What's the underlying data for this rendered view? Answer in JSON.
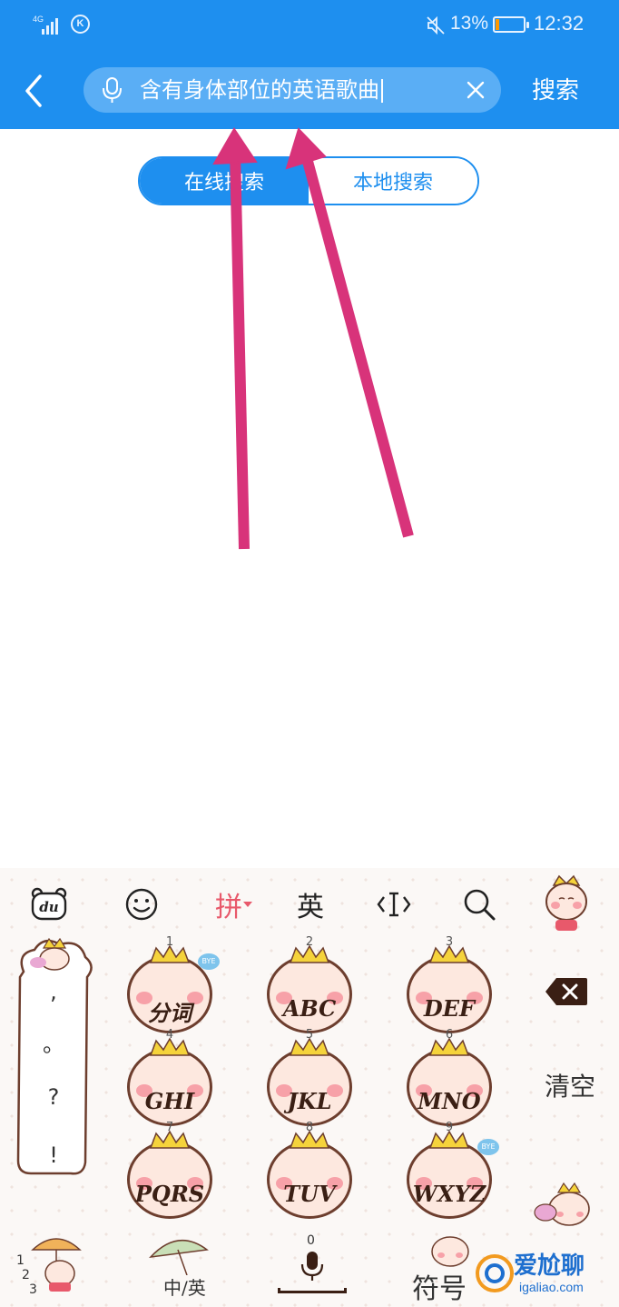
{
  "status_bar": {
    "network_type": "4G",
    "carrier_badge": "K",
    "battery_percent": "13%",
    "battery_level": 0.13,
    "time": "12:32",
    "icons": [
      "signal-icon",
      "mute-icon",
      "battery-icon"
    ]
  },
  "header": {
    "back_icon": "chevron-left-icon",
    "search": {
      "value": "含有身体部位的英语歌曲",
      "mic_icon": "voice-search-icon",
      "clear_icon": "close-icon"
    },
    "search_button": "搜索"
  },
  "tabs": [
    {
      "label": "在线搜索",
      "active": true
    },
    {
      "label": "本地搜索",
      "active": false
    }
  ],
  "annotations": {
    "arrow_color": "#d8337a",
    "count": 2
  },
  "keyboard": {
    "toolbar": {
      "pinyin": "拼",
      "english": "英",
      "icons": [
        "du-logo-icon",
        "emoji-icon",
        "cursor-icon",
        "search-icon",
        "mascot-icon"
      ]
    },
    "punctuation": [
      ",",
      "。",
      "?",
      "!"
    ],
    "keys": [
      {
        "num": "1",
        "label": "分词"
      },
      {
        "num": "2",
        "label": "ABC"
      },
      {
        "num": "3",
        "label": "DEF"
      },
      {
        "num": "4",
        "label": "GHI"
      },
      {
        "num": "5",
        "label": "JKL"
      },
      {
        "num": "6",
        "label": "MNO"
      },
      {
        "num": "7",
        "label": "PQRS"
      },
      {
        "num": "8",
        "label": "TUV"
      },
      {
        "num": "9",
        "label": "WXYZ"
      }
    ],
    "bye_badge": "BYE",
    "clear_label": "清空",
    "bottom": {
      "numbers": [
        "1",
        "2",
        "3"
      ],
      "lang_switch": "中/英",
      "zero": "0",
      "symbols": "符号"
    }
  },
  "watermark": {
    "text": "爱尬聊",
    "sub": "igaliao.com"
  }
}
